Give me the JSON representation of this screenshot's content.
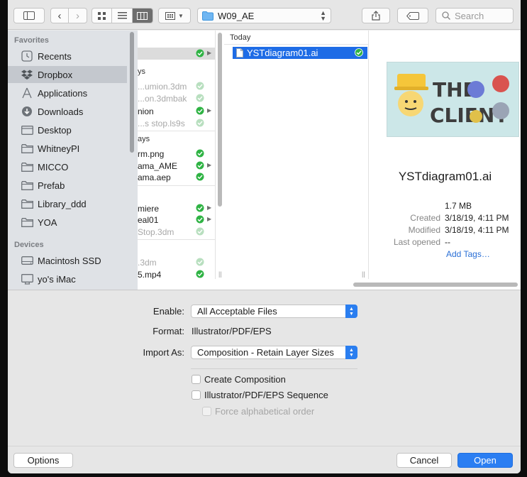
{
  "toolbar": {
    "path_label": "W09_AE",
    "search_placeholder": "Search"
  },
  "sidebar": {
    "favorites_header": "Favorites",
    "devices_header": "Devices",
    "favorites": [
      {
        "label": "Recents",
        "icon": "clock-icon"
      },
      {
        "label": "Dropbox",
        "icon": "dropbox-icon",
        "selected": true
      },
      {
        "label": "Applications",
        "icon": "applications-icon"
      },
      {
        "label": "Downloads",
        "icon": "downloads-icon"
      },
      {
        "label": "Desktop",
        "icon": "desktop-icon"
      },
      {
        "label": "WhitneyPI",
        "icon": "folder-icon"
      },
      {
        "label": "MICCO",
        "icon": "folder-icon"
      },
      {
        "label": "Prefab",
        "icon": "folder-icon"
      },
      {
        "label": "Library_ddd",
        "icon": "folder-icon"
      },
      {
        "label": "YOA",
        "icon": "folder-icon"
      }
    ],
    "devices": [
      {
        "label": "Macintosh SSD",
        "icon": "hard-drive-icon"
      },
      {
        "label": "yo's iMac",
        "icon": "imac-icon"
      }
    ]
  },
  "column1": {
    "rows": [
      {
        "name": "",
        "check": true,
        "arrow": true,
        "highlight": true
      },
      {
        "header": "ys"
      },
      {
        "name": "...umion.3dm",
        "check": true,
        "dim": true
      },
      {
        "name": "...on.3dmbak",
        "check": true,
        "dim": true
      },
      {
        "name": "nion",
        "check": true,
        "arrow": true
      },
      {
        "name": "...s stop.ls9s",
        "check": true,
        "dim": true
      },
      {
        "header": "ays"
      },
      {
        "name": "rm.png",
        "check": true
      },
      {
        "name": "ama_AME",
        "check": true,
        "arrow": true
      },
      {
        "name": "ama.aep",
        "check": true
      },
      {
        "header": ""
      },
      {
        "name": "miere",
        "check": true,
        "arrow": true
      },
      {
        "name": "eal01",
        "check": true,
        "arrow": true
      },
      {
        "name": "Stop.3dm",
        "check": true,
        "dim": true
      },
      {
        "header": ""
      },
      {
        "name": ".3dm",
        "check": true,
        "dim": true
      },
      {
        "name": "5.mp4",
        "check": true
      }
    ]
  },
  "column2": {
    "header": "Today",
    "selected_file": "YSTdiagram01.ai"
  },
  "preview": {
    "filename": "YSTdiagram01.ai",
    "size": "1.7 MB",
    "created_label": "Created",
    "created_value": "3/18/19, 4:11 PM",
    "modified_label": "Modified",
    "modified_value": "3/18/19, 4:11 PM",
    "last_opened_label": "Last opened",
    "last_opened_value": "--",
    "add_tags": "Add Tags…",
    "thumb_text_line1": "THE",
    "thumb_text_line2": "CLIENT"
  },
  "options": {
    "enable_label": "Enable:",
    "enable_value": "All Acceptable Files",
    "format_label": "Format:",
    "format_value": "Illustrator/PDF/EPS",
    "import_as_label": "Import As:",
    "import_as_value": "Composition - Retain Layer Sizes",
    "create_composition": "Create Composition",
    "sequence": "Illustrator/PDF/EPS Sequence",
    "force_alpha": "Force alphabetical order"
  },
  "buttons": {
    "options": "Options",
    "cancel": "Cancel",
    "open": "Open"
  },
  "colors": {
    "accent": "#2b7ef2",
    "selection": "#1e6ce6",
    "check_green": "#2fb344"
  }
}
